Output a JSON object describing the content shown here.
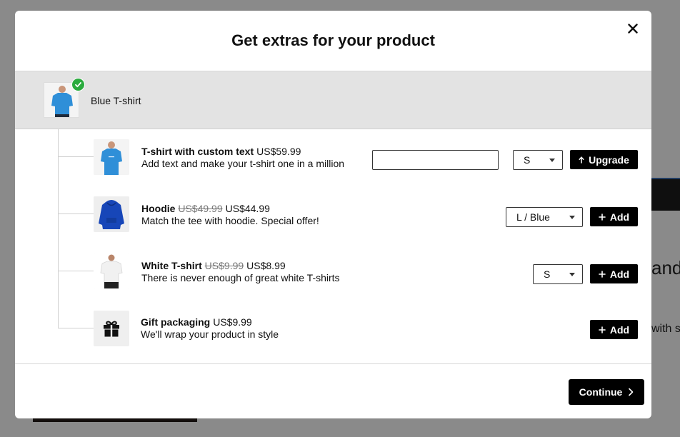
{
  "background": {
    "text_1": "and",
    "text_2": "with s"
  },
  "modal": {
    "title": "Get extras for your product",
    "close_icon": "close-icon",
    "main_product": {
      "name": "Blue T-shirt",
      "badge_icon": "check-icon",
      "badge_color": "#2bab3e"
    },
    "extras": [
      {
        "title": "T-shirt with custom text",
        "old_price": "",
        "price": "US$59.99",
        "description": "Add text and make your t-shirt one in a million",
        "input_value": "",
        "select_value": "S",
        "button_label": "Upgrade",
        "button_icon": "arrow-up-icon"
      },
      {
        "title": "Hoodie",
        "old_price": "US$49.99",
        "price": "US$44.99",
        "description": "Match the tee with hoodie. Special offer!",
        "select_value": "L / Blue",
        "button_label": "Add",
        "button_icon": "plus-icon"
      },
      {
        "title": "White T-shirt",
        "old_price": "US$9.99",
        "price": "US$8.99",
        "description": "There is never enough of great white T-shirts",
        "select_value": "S",
        "button_label": "Add",
        "button_icon": "plus-icon"
      },
      {
        "title": "Gift packaging",
        "old_price": "",
        "price": "US$9.99",
        "description": "We'll wrap your product in style",
        "button_label": "Add",
        "button_icon": "plus-icon",
        "thumb_icon": "gift-icon"
      }
    ],
    "footer": {
      "continue_label": "Continue",
      "continue_icon": "chevron-right-icon"
    }
  }
}
